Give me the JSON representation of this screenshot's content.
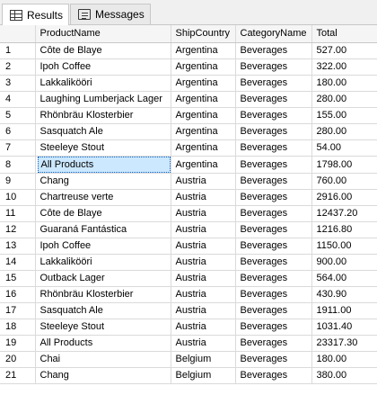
{
  "tabs": [
    {
      "label": "Results",
      "icon": "results-grid-icon",
      "active": true
    },
    {
      "label": "Messages",
      "icon": "messages-icon",
      "active": false
    }
  ],
  "grid": {
    "columns": [
      "",
      "ProductName",
      "ShipCountry",
      "CategoryName",
      "Total"
    ],
    "selected_cell": {
      "row": 8,
      "column": "ProductName"
    },
    "selection_color": "#cce8ff",
    "rows": [
      {
        "n": "1",
        "product": "Côte de Blaye",
        "country": "Argentina",
        "category": "Beverages",
        "total": "527.00"
      },
      {
        "n": "2",
        "product": "Ipoh Coffee",
        "country": "Argentina",
        "category": "Beverages",
        "total": "322.00"
      },
      {
        "n": "3",
        "product": "Lakkalikööri",
        "country": "Argentina",
        "category": "Beverages",
        "total": "180.00"
      },
      {
        "n": "4",
        "product": "Laughing Lumberjack Lager",
        "country": "Argentina",
        "category": "Beverages",
        "total": "280.00"
      },
      {
        "n": "5",
        "product": "Rhönbräu Klosterbier",
        "country": "Argentina",
        "category": "Beverages",
        "total": "155.00"
      },
      {
        "n": "6",
        "product": "Sasquatch Ale",
        "country": "Argentina",
        "category": "Beverages",
        "total": "280.00"
      },
      {
        "n": "7",
        "product": "Steeleye Stout",
        "country": "Argentina",
        "category": "Beverages",
        "total": "54.00"
      },
      {
        "n": "8",
        "product": "All Products",
        "country": "Argentina",
        "category": "Beverages",
        "total": "1798.00"
      },
      {
        "n": "9",
        "product": "Chang",
        "country": "Austria",
        "category": "Beverages",
        "total": "760.00"
      },
      {
        "n": "10",
        "product": "Chartreuse verte",
        "country": "Austria",
        "category": "Beverages",
        "total": "2916.00"
      },
      {
        "n": "11",
        "product": "Côte de Blaye",
        "country": "Austria",
        "category": "Beverages",
        "total": "12437.20"
      },
      {
        "n": "12",
        "product": "Guaraná Fantástica",
        "country": "Austria",
        "category": "Beverages",
        "total": "1216.80"
      },
      {
        "n": "13",
        "product": "Ipoh Coffee",
        "country": "Austria",
        "category": "Beverages",
        "total": "1150.00"
      },
      {
        "n": "14",
        "product": "Lakkalikööri",
        "country": "Austria",
        "category": "Beverages",
        "total": "900.00"
      },
      {
        "n": "15",
        "product": "Outback Lager",
        "country": "Austria",
        "category": "Beverages",
        "total": "564.00"
      },
      {
        "n": "16",
        "product": "Rhönbräu Klosterbier",
        "country": "Austria",
        "category": "Beverages",
        "total": "430.90"
      },
      {
        "n": "17",
        "product": "Sasquatch Ale",
        "country": "Austria",
        "category": "Beverages",
        "total": "1911.00"
      },
      {
        "n": "18",
        "product": "Steeleye Stout",
        "country": "Austria",
        "category": "Beverages",
        "total": "1031.40"
      },
      {
        "n": "19",
        "product": "All Products",
        "country": "Austria",
        "category": "Beverages",
        "total": "23317.30"
      },
      {
        "n": "20",
        "product": "Chai",
        "country": "Belgium",
        "category": "Beverages",
        "total": "180.00"
      },
      {
        "n": "21",
        "product": "Chang",
        "country": "Belgium",
        "category": "Beverages",
        "total": "380.00"
      }
    ]
  }
}
